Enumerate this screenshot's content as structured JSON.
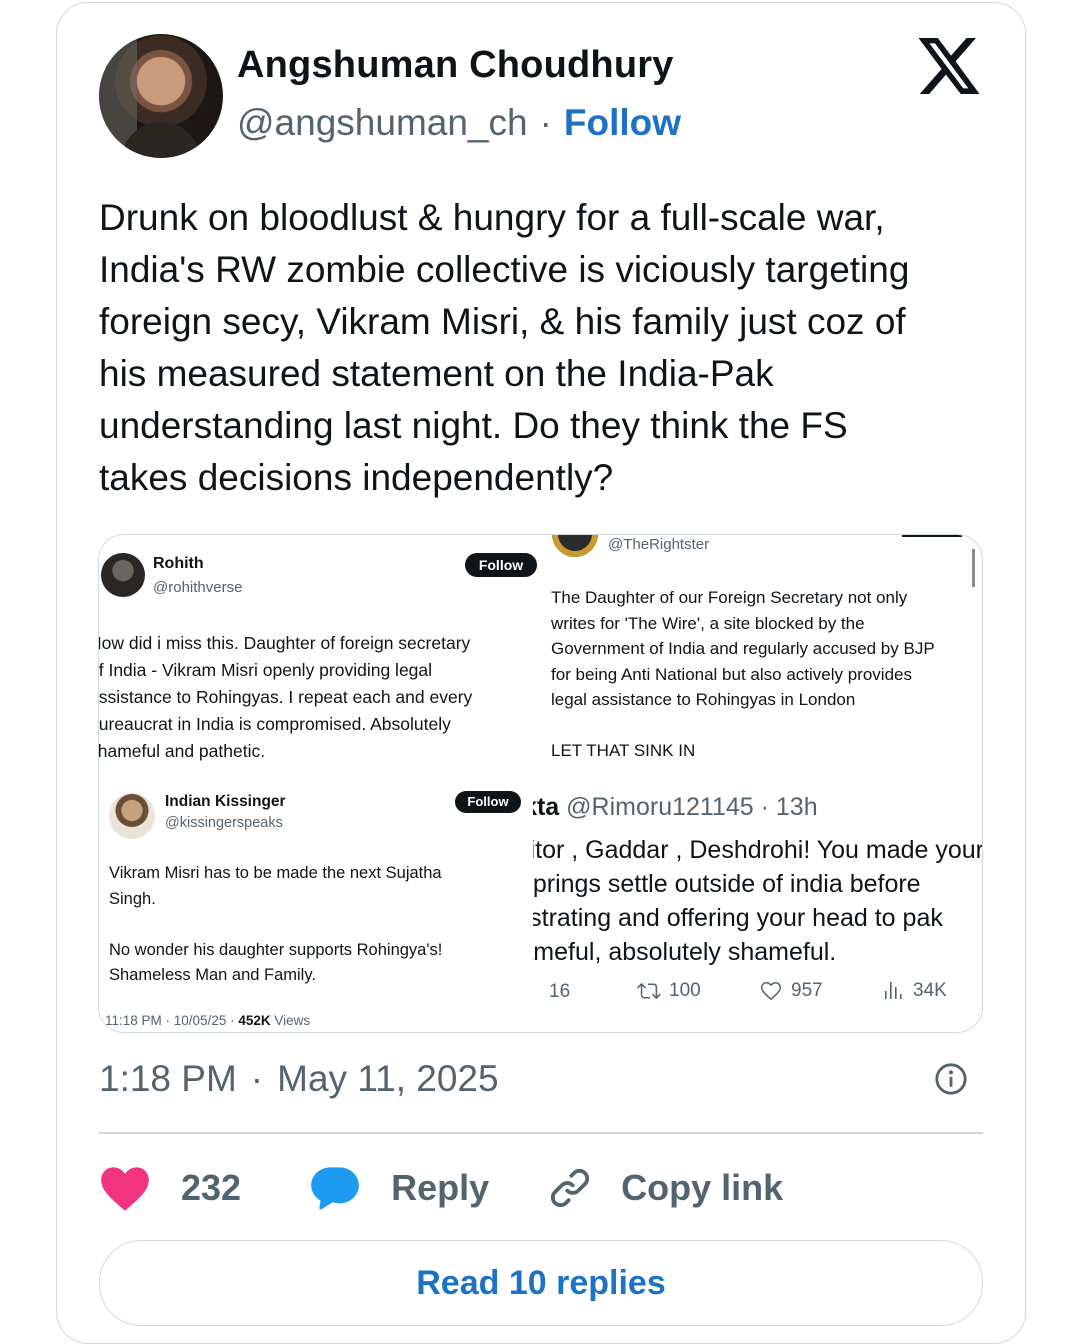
{
  "author": {
    "name": "Angshuman Choudhury",
    "handle": "@angshuman_ch",
    "separator": "·",
    "follow_label": "Follow"
  },
  "tweet": {
    "text": "Drunk on bloodlust & hungry for a full-scale war,\nIndia's RW zombie collective is viciously targeting\nforeign secy, Vikram Misri, & his family just coz of\nhis measured statement on the India-Pak\nunderstanding last night. Do they think the FS\ntakes decisions independently?"
  },
  "media": {
    "post1": {
      "name": "Rohith",
      "handle": "@rohithverse",
      "follow_label": "Follow",
      "text": "How did i miss this. Daughter of foreign secretary\nof India - Vikram Misri openly providing legal\nassistance to Rohingyas. I repeat each and every\nbureaucrat in India is compromised. Absolutely\nshameful and pathetic."
    },
    "post2": {
      "handle": "@TheRightster",
      "text": "The Daughter of our Foreign Secretary not only\nwrites for 'The Wire', a site blocked by the\nGovernment of India and regularly accused by BJP\nfor being Anti National but also actively provides\nlegal assistance to Rohingyas in London\n\nLET THAT SINK IN"
    },
    "post3": {
      "name": "Indian Kissinger",
      "handle": "@kissingerspeaks",
      "follow_label": "Follow",
      "text": "Vikram Misri has to be made the next Sujatha\nSingh.\n\nNo wonder his daughter supports Rohingya's!\nShameless Man and Family.",
      "meta_time": "11:18 PM · 10/05/25 · ",
      "meta_views_count": "452K",
      "meta_views_label": " Views"
    },
    "post4": {
      "name": "Sanjukta",
      "handle": "@Rimoru121145 · 13h",
      "text": "Traitor , Gaddar , Deshdrohi! You made your\noffsprings settle outside of india before\nprostrating and offering your head to pak\nshameful, absolutely shameful.",
      "replies": "16",
      "reposts": "100",
      "likes": "957",
      "views": "34K"
    }
  },
  "timestamp": {
    "time": "1:18 PM",
    "separator": "·",
    "date": "May 11, 2025"
  },
  "actions": {
    "likes_count": "232",
    "reply_label": "Reply",
    "copy_label": "Copy link"
  },
  "read_replies_label": "Read 10 replies",
  "colors": {
    "accent": "#1d72c6",
    "heart": "#f0347f",
    "reply_bubble": "#1d9bf0",
    "muted": "#536471"
  }
}
